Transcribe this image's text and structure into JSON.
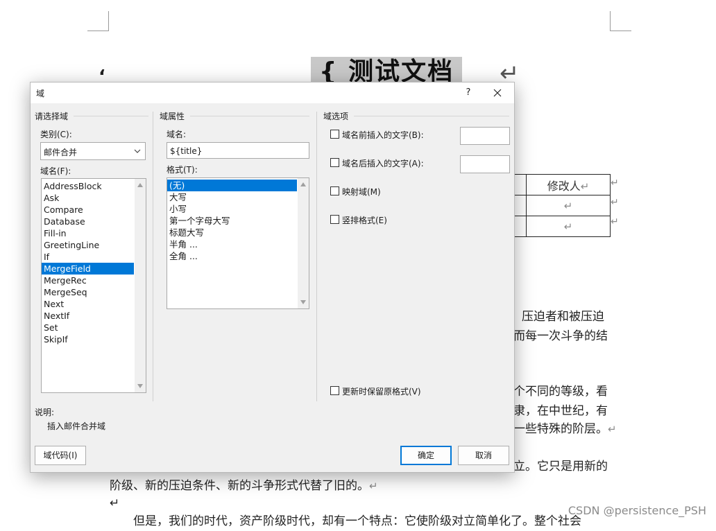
{
  "document": {
    "title": "{ 测试文档 }",
    "return_mark": "↵",
    "table_header": "修改人",
    "para1": "压迫者和被压迫",
    "para2": "而每一次斗争的结",
    "para3": "个不同的等级，看",
    "para4": "隶，在中世纪，有",
    "para5": "一些特殊的阶层。",
    "para6": "立。它只是用新的",
    "para7": "阶级、新的压迫条件、新的斗争形式代替了旧的。",
    "para8": "但是，我们的时代，资产阶级时代，却有一个特点：它使阶级对立简单化了。整个社会",
    "watermark": "CSDN @persistence_PSH"
  },
  "dialog": {
    "title": "域",
    "help": "?",
    "left_group": "请选择域",
    "category_label": "类别(C):",
    "category_value": "邮件合并",
    "field_names_label": "域名(F):",
    "field_names": [
      "AddressBlock",
      "Ask",
      "Compare",
      "Database",
      "Fill-in",
      "GreetingLine",
      "If",
      "MergeField",
      "MergeRec",
      "MergeSeq",
      "Next",
      "NextIf",
      "Set",
      "SkipIf"
    ],
    "selected_field": "MergeField",
    "props_group": "域属性",
    "field_name_label": "域名:",
    "field_name_value": "${title}",
    "format_label": "格式(T):",
    "formats": [
      "(无)",
      "大写",
      "小写",
      "第一个字母大写",
      "标题大写",
      "半角 ...",
      "全角 ..."
    ],
    "selected_format": "(无)",
    "options_group": "域选项",
    "opt_before": "域名前插入的文字(B):",
    "opt_after": "域名后插入的文字(A):",
    "opt_mapped": "映射域(M)",
    "opt_vertical": "竖排格式(E)",
    "opt_preserve": "更新时保留原格式(V)",
    "desc_label": "说明:",
    "desc_text": "插入邮件合并域",
    "field_codes_btn": "域代码(I)",
    "ok_btn": "确定",
    "cancel_btn": "取消"
  }
}
